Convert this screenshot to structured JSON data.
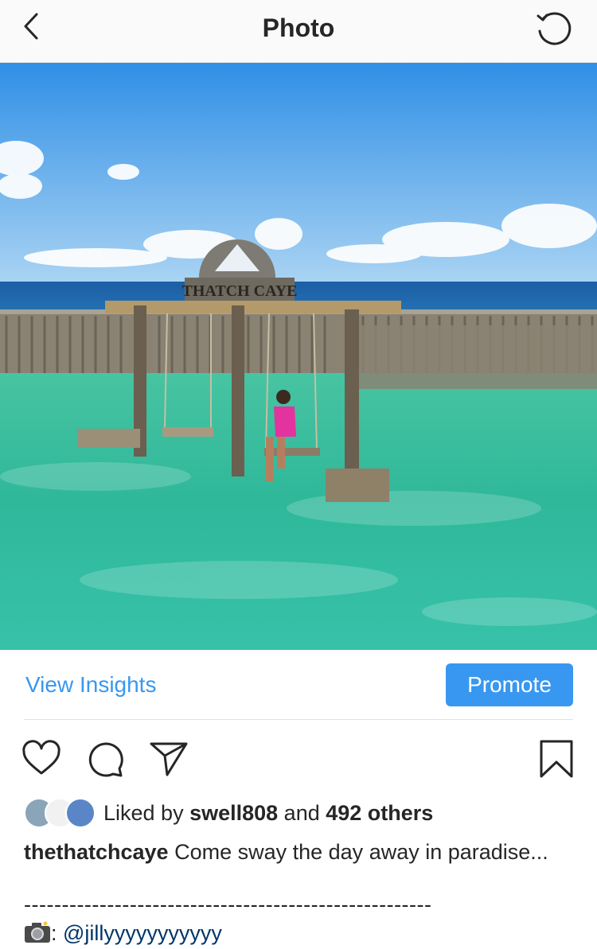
{
  "nav": {
    "title": "Photo"
  },
  "photo": {
    "sign_text": "THATCH CAYE"
  },
  "insights": {
    "link_label": "View Insights",
    "promote_label": "Promote"
  },
  "likes": {
    "prefix": "Liked by ",
    "user": "swell808",
    "middle": " and ",
    "others": "492 others"
  },
  "caption": {
    "username": "thethatchcaye",
    "text": " Come sway the day away in paradise...",
    "separator": "------------------------------------------------------",
    "credit_prefix": ": ",
    "credit_handle": "@jillyyyyyyyyyyy"
  },
  "icons": [
    "back-arrow-icon",
    "refresh-icon",
    "heart-icon",
    "comment-icon",
    "share-icon",
    "bookmark-icon",
    "camera-icon"
  ],
  "colors": {
    "accent": "#3897f0",
    "link": "#003569",
    "text": "#262626"
  }
}
